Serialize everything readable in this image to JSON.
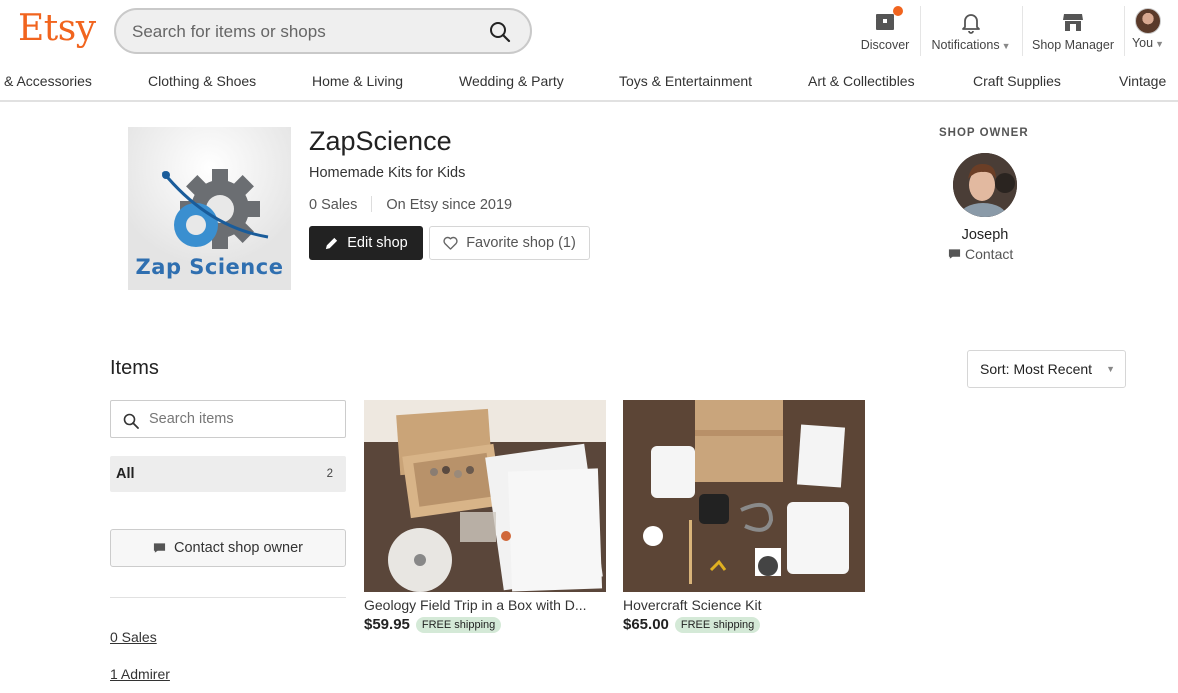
{
  "header": {
    "logo": "Etsy",
    "search_placeholder": "Search for items or shops",
    "nav": {
      "discover": "Discover",
      "notifications": "Notifications",
      "shop_manager": "Shop Manager",
      "you": "You"
    }
  },
  "categories": [
    "& Accessories",
    "Clothing & Shoes",
    "Home & Living",
    "Wedding & Party",
    "Toys & Entertainment",
    "Art & Collectibles",
    "Craft Supplies",
    "Vintage"
  ],
  "shop": {
    "logo_text": "Zap Science",
    "name": "ZapScience",
    "tagline": "Homemade Kits for Kids",
    "sales": "0 Sales",
    "since": "On Etsy since 2019",
    "edit_label": "Edit shop",
    "favorite_label": "Favorite shop (1)"
  },
  "owner": {
    "heading": "SHOP OWNER",
    "name": "Joseph",
    "contact": "Contact"
  },
  "items": {
    "title": "Items",
    "sort_label": "Sort: Most Recent",
    "search_placeholder": "Search items",
    "sections": [
      {
        "label": "All",
        "count": "2"
      }
    ],
    "contact_owner": "Contact shop owner",
    "sales_link": "0 Sales",
    "admirer_link": "1 Admirer"
  },
  "listings": [
    {
      "title": "Geology Field Trip in a Box with D...",
      "price": "$59.95",
      "shipping": "FREE shipping"
    },
    {
      "title": "Hovercraft Science Kit",
      "price": "$65.00",
      "shipping": "FREE shipping"
    }
  ],
  "colors": {
    "brand": "#F1641E",
    "shipping_badge": "#d4e9d7",
    "edit_button": "#222222"
  }
}
